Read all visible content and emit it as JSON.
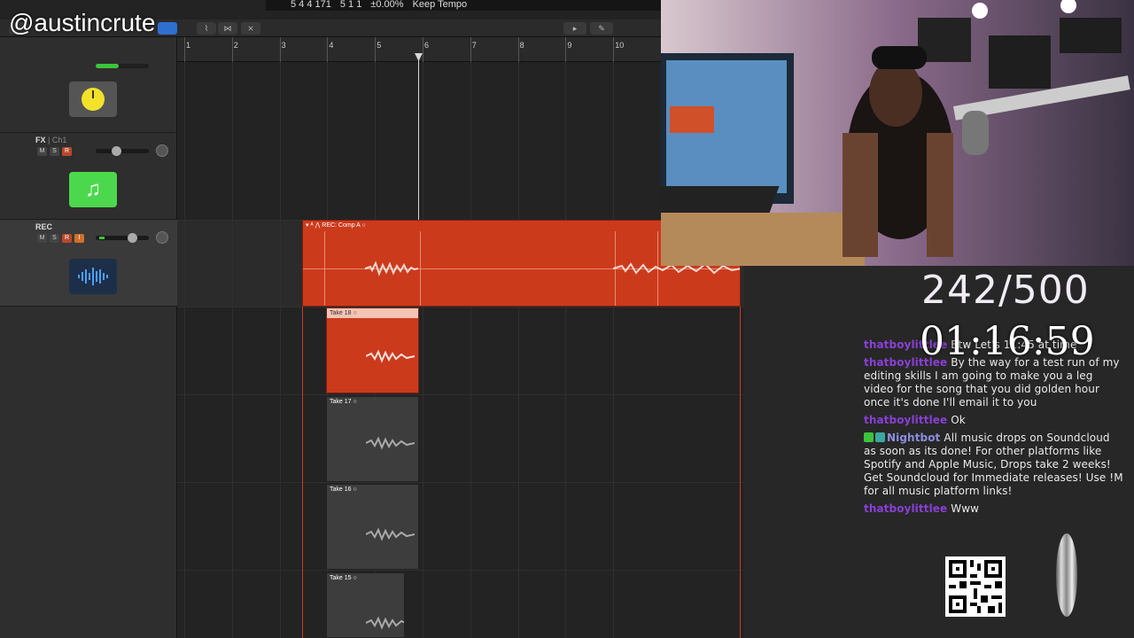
{
  "overlay": {
    "handle": "@austincrute",
    "counter": "242/500",
    "timer": "01:16:59"
  },
  "lcd": {
    "position": "5 4 4 171",
    "position2": "5 1 1",
    "percent": "±0.00%",
    "mode": "Keep Tempo"
  },
  "ruler": {
    "bars": [
      "1",
      "2",
      "3",
      "4",
      "5",
      "6",
      "7",
      "8",
      "9",
      "10"
    ]
  },
  "tracks": [
    {
      "name": "",
      "sub": "",
      "icon": "knob-icon",
      "color": "#f2e22a"
    },
    {
      "name": "FX",
      "sub": "Ch1",
      "buttons": [
        "M",
        "S",
        "R"
      ],
      "icon": "music-note-icon",
      "color": "#4cd84c"
    },
    {
      "name": "REC",
      "sub": "",
      "buttons": [
        "M",
        "S",
        "R",
        "I"
      ],
      "icon": "waveform-icon",
      "color": "#3a8ee8"
    }
  ],
  "regions": {
    "comp_label": "REC: Comp A",
    "takes": [
      "Take 18",
      "Take 17",
      "Take 16",
      "Take 15"
    ]
  },
  "chat": [
    {
      "user": "thatboylittlee",
      "text": "Btw Let's 11:45 at time"
    },
    {
      "user": "thatboylittlee",
      "text": "By the way for a test run of my editing skills I am going to make you a leg video for the song that you did golden hour once it's done I'll email it to you"
    },
    {
      "user": "thatboylittlee",
      "text": "Ok"
    },
    {
      "user": "Nightbot",
      "text": "All music drops on Soundcloud as soon as its done! For other platforms like Spotify and Apple Music, Drops take 2 weeks! Get Soundcloud for Immediate releases! Use !M for all music platform links!",
      "bot": true
    },
    {
      "user": "thatboylittlee",
      "text": "Www"
    }
  ],
  "colors": {
    "region_red": "#cc3a1c",
    "region_gray": "#3d3d3d",
    "username": "#8a3fd6"
  }
}
